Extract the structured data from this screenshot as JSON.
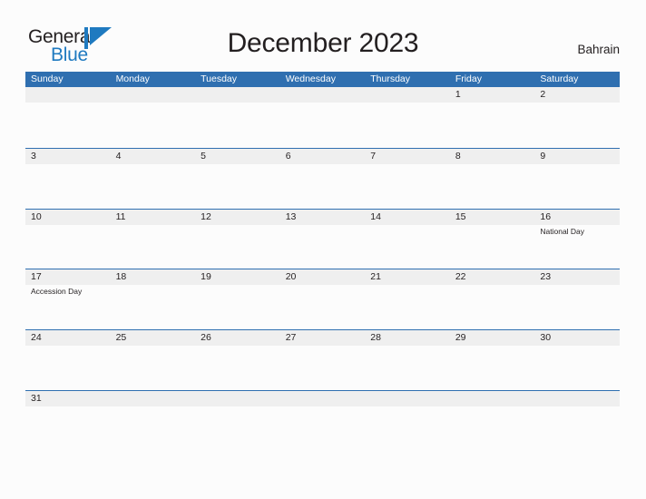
{
  "brand": {
    "name_part1": "General",
    "name_part2": "Blue",
    "mark": "triangle-flag-logo",
    "color_text": "#231f20",
    "color_blue": "#1f7ac0"
  },
  "header": {
    "title": "December 2023",
    "region": "Bahrain"
  },
  "calendar": {
    "month": "December",
    "year": "2023",
    "header_color": "#2f6fb0",
    "band_color": "#efefef",
    "weekdays": [
      "Sunday",
      "Monday",
      "Tuesday",
      "Wednesday",
      "Thursday",
      "Friday",
      "Saturday"
    ],
    "weeks": [
      {
        "days": [
          {
            "number": "",
            "event": ""
          },
          {
            "number": "",
            "event": ""
          },
          {
            "number": "",
            "event": ""
          },
          {
            "number": "",
            "event": ""
          },
          {
            "number": "",
            "event": ""
          },
          {
            "number": "1",
            "event": ""
          },
          {
            "number": "2",
            "event": ""
          }
        ]
      },
      {
        "days": [
          {
            "number": "3",
            "event": ""
          },
          {
            "number": "4",
            "event": ""
          },
          {
            "number": "5",
            "event": ""
          },
          {
            "number": "6",
            "event": ""
          },
          {
            "number": "7",
            "event": ""
          },
          {
            "number": "8",
            "event": ""
          },
          {
            "number": "9",
            "event": ""
          }
        ]
      },
      {
        "days": [
          {
            "number": "10",
            "event": ""
          },
          {
            "number": "11",
            "event": ""
          },
          {
            "number": "12",
            "event": ""
          },
          {
            "number": "13",
            "event": ""
          },
          {
            "number": "14",
            "event": ""
          },
          {
            "number": "15",
            "event": ""
          },
          {
            "number": "16",
            "event": "National Day"
          }
        ]
      },
      {
        "days": [
          {
            "number": "17",
            "event": "Accession Day"
          },
          {
            "number": "18",
            "event": ""
          },
          {
            "number": "19",
            "event": ""
          },
          {
            "number": "20",
            "event": ""
          },
          {
            "number": "21",
            "event": ""
          },
          {
            "number": "22",
            "event": ""
          },
          {
            "number": "23",
            "event": ""
          }
        ]
      },
      {
        "days": [
          {
            "number": "24",
            "event": ""
          },
          {
            "number": "25",
            "event": ""
          },
          {
            "number": "26",
            "event": ""
          },
          {
            "number": "27",
            "event": ""
          },
          {
            "number": "28",
            "event": ""
          },
          {
            "number": "29",
            "event": ""
          },
          {
            "number": "30",
            "event": ""
          }
        ]
      },
      {
        "days": [
          {
            "number": "31",
            "event": ""
          },
          {
            "number": "",
            "event": ""
          },
          {
            "number": "",
            "event": ""
          },
          {
            "number": "",
            "event": ""
          },
          {
            "number": "",
            "event": ""
          },
          {
            "number": "",
            "event": ""
          },
          {
            "number": "",
            "event": ""
          }
        ]
      }
    ]
  }
}
